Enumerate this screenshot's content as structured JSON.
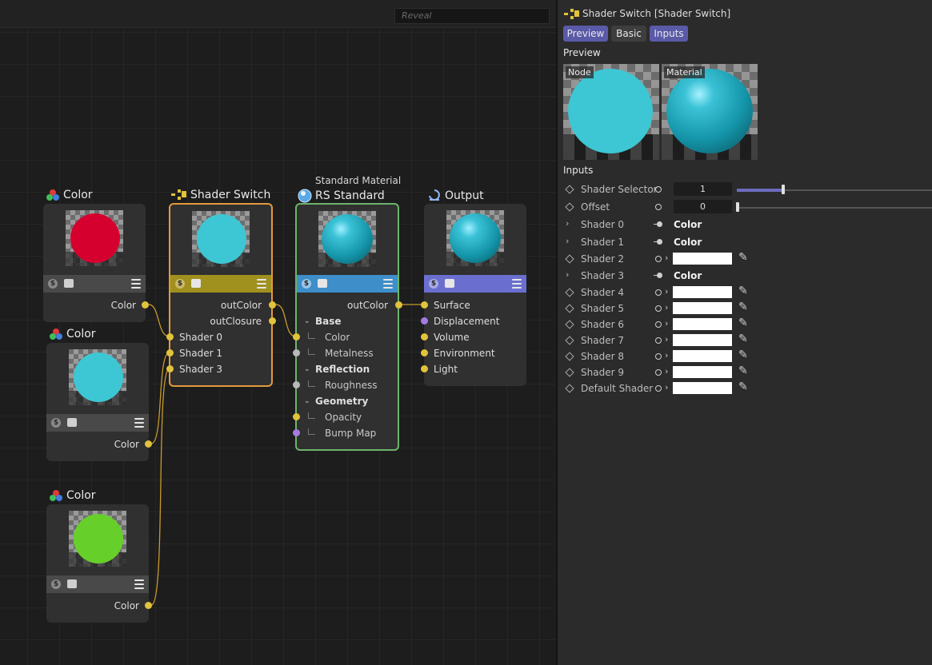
{
  "search": {
    "placeholder": "Reveal"
  },
  "nodes": {
    "color_red": {
      "title": "Color",
      "port": "Color",
      "color": "#d6002f"
    },
    "color_cyan": {
      "title": "Color",
      "port": "Color",
      "color": "#3dc6d4"
    },
    "color_green": {
      "title": "Color",
      "port": "Color",
      "color": "#67cf2a"
    },
    "shader_switch": {
      "title": "Shader Switch",
      "outputs": [
        "outColor",
        "outClosure"
      ],
      "inputs": [
        "Shader 0",
        "Shader 1",
        "Shader 3"
      ],
      "strip_color": "#a0901e",
      "preview_color": "#3dc6d4"
    },
    "rs_standard": {
      "subtitle": "Standard Material",
      "title": "RS Standard",
      "output": "outColor",
      "groups": [
        {
          "label": "Base",
          "items": [
            "Color",
            "Metalness"
          ]
        },
        {
          "label": "Reflection",
          "items": [
            "Roughness"
          ]
        },
        {
          "label": "Geometry",
          "items": [
            "Opacity",
            "Bump Map"
          ]
        }
      ],
      "strip_color": "#3d8ec9"
    },
    "output": {
      "title": "Output",
      "inputs": [
        "Surface",
        "Displacement",
        "Volume",
        "Environment",
        "Light"
      ],
      "strip_color": "#6a6fcf"
    }
  },
  "panel": {
    "title": "Shader Switch [Shader Switch]",
    "tabs": [
      {
        "label": "Preview",
        "active": true
      },
      {
        "label": "Basic",
        "active": false
      },
      {
        "label": "Inputs",
        "active": true
      }
    ],
    "preview_heading": "Preview",
    "preview_node_label": "Node",
    "preview_material_label": "Material",
    "inputs_heading": "Inputs",
    "shader_selector": {
      "label": "Shader Selector",
      "value": "1",
      "slider_fraction": 0.3
    },
    "offset": {
      "label": "Offset",
      "value": "0",
      "slider_fraction": 0.0
    },
    "shaders": [
      {
        "label": "Shader 0",
        "linked": true,
        "link_text": "Color"
      },
      {
        "label": "Shader 1",
        "linked": true,
        "link_text": "Color"
      },
      {
        "label": "Shader 2",
        "linked": false
      },
      {
        "label": "Shader 3",
        "linked": true,
        "link_text": "Color"
      },
      {
        "label": "Shader 4",
        "linked": false
      },
      {
        "label": "Shader 5",
        "linked": false
      },
      {
        "label": "Shader 6",
        "linked": false
      },
      {
        "label": "Shader 7",
        "linked": false
      },
      {
        "label": "Shader 8",
        "linked": false
      },
      {
        "label": "Shader 9",
        "linked": false
      },
      {
        "label": "Default Shader",
        "linked": false
      }
    ]
  }
}
